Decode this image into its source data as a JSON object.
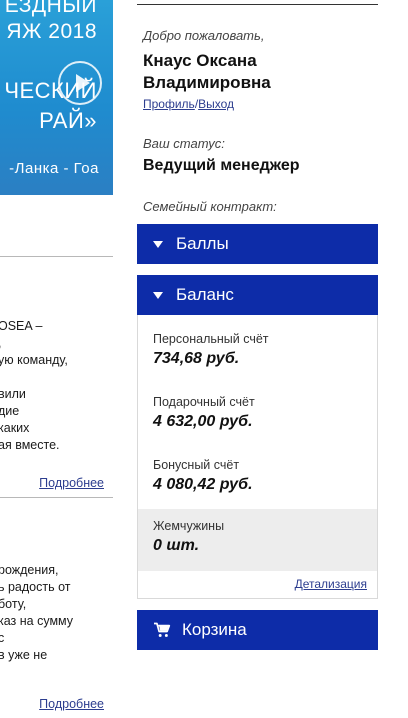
{
  "banner": {
    "line1": "ЕЗДНЫЙ",
    "line2": "ЯЖ 2018",
    "line3": "ЧЕСКИЙ",
    "line4": "РАЙ»",
    "line5": "-Ланка - Гоа"
  },
  "news": [
    {
      "lines": [
        "OSEA –",
        ",",
        "ую команду,",
        "",
        "вили",
        "дие",
        "каких",
        "ая вместе."
      ],
      "more_label": "Подробнее"
    },
    {
      "lines": [
        "рождения,",
        "ь радость от",
        "боту,",
        "каз на сумму",
        "с",
        "в уже не"
      ],
      "more_label": "Подробнее"
    }
  ],
  "user": {
    "welcome": "Добро пожаловать,",
    "name": "Кнаус Оксана Владимировна",
    "profile_link": "Профиль",
    "separator": "/",
    "logout_link": "Выход",
    "status_label": "Ваш статус:",
    "status_value": "Ведущий менеджер",
    "family_label": "Семейный контракт:"
  },
  "accordion": {
    "points_label": "Баллы",
    "balance_label": "Баланс",
    "cart_label": "Корзина"
  },
  "balance": {
    "personal_label": "Персональный счёт",
    "personal_value": "734,68 руб.",
    "gift_label": "Подарочный счёт",
    "gift_value": "4 632,00 руб.",
    "bonus_label": "Бонусный счёт",
    "bonus_value": "4 080,42 руб.",
    "pearls_label": "Жемчужины",
    "pearls_value": "0 шт.",
    "detail_link": "Детализация"
  },
  "colors": {
    "accent": "#0d2ca8",
    "link": "#2c3d8f",
    "banner": "#1f8ccf",
    "panel_gray": "#ededed"
  }
}
